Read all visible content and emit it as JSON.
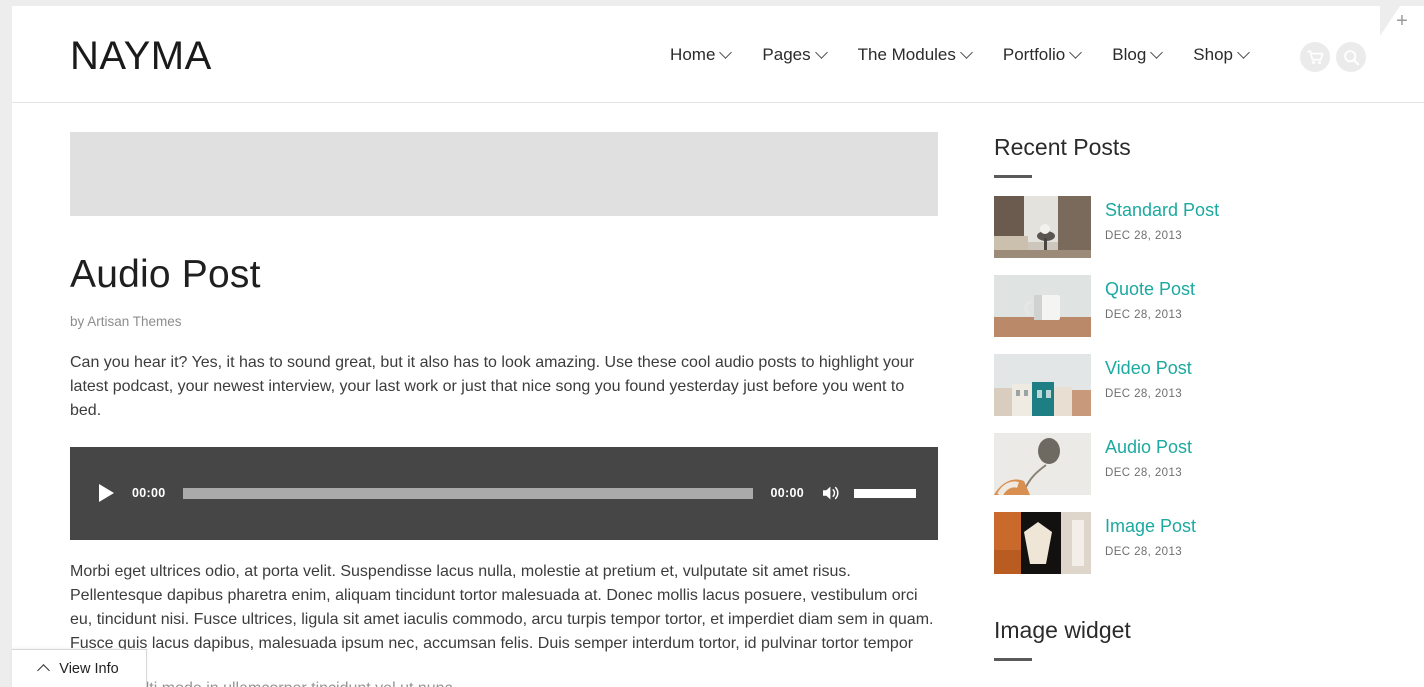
{
  "header": {
    "logo": "NAYMA",
    "nav": [
      {
        "label": "Home",
        "has_dropdown": true
      },
      {
        "label": "Pages",
        "has_dropdown": true
      },
      {
        "label": "The Modules",
        "has_dropdown": true
      },
      {
        "label": "Portfolio",
        "has_dropdown": true
      },
      {
        "label": "Blog",
        "has_dropdown": true
      },
      {
        "label": "Shop",
        "has_dropdown": true
      }
    ],
    "icons": [
      {
        "name": "cart-icon"
      },
      {
        "name": "search-icon"
      }
    ],
    "corner_toggle": "+"
  },
  "post": {
    "title": "Audio Post",
    "byline": "by Artisan Themes",
    "paragraph_1": "Can you hear it? Yes, it has to sound great, but it also has to look amazing. Use these cool audio posts to highlight your latest podcast, your newest interview, your last work or just that nice song you found yesterday just before you went to bed.",
    "paragraph_2": "Morbi eget ultrices odio, at porta velit. Suspendisse lacus nulla, molestie at pretium et, vulputate sit amet risus. Pellentesque dapibus pharetra enim, aliquam tincidunt tortor malesuada at. Donec mollis lacus posuere, vestibulum orci eu, tincidunt nisi. Fusce ultrices, ligula sit amet iaculis commodo, arcu turpis tempor tortor, et imperdiet diam sem in quam. Fusce quis lacus dapibus, malesuada ipsum nec, accumsan felis. Duis semper interdum tortor, id pulvinar tortor tempor non.",
    "paragraph_3_clipped": "Vivamus multi mode in ullamcorper tincidunt vel ut nunc"
  },
  "audio_player": {
    "current_time": "00:00",
    "duration": "00:00",
    "play_label": "play-button",
    "mute_label": "mute-button",
    "progress_percent": 0,
    "volume_percent": 100
  },
  "sidebar": {
    "recent_posts_widget": {
      "title": "Recent Posts",
      "posts": [
        {
          "title": "Standard Post",
          "date": "DEC 28, 2013",
          "thumb": "living-room"
        },
        {
          "title": "Quote Post",
          "date": "DEC 28, 2013",
          "thumb": "mug"
        },
        {
          "title": "Video Post",
          "date": "DEC 28, 2013",
          "thumb": "buildings"
        },
        {
          "title": "Audio Post",
          "date": "DEC 28, 2013",
          "thumb": "flowers-hand"
        },
        {
          "title": "Image Post",
          "date": "DEC 28, 2013",
          "thumb": "kitchen"
        }
      ]
    },
    "image_widget": {
      "title": "Image widget"
    }
  },
  "footer_bar": {
    "view_info_label": "View Info"
  },
  "colors": {
    "accent_teal": "#1ba9a0",
    "player_bg": "#464646",
    "placeholder_gray": "#e0e0e0",
    "page_bg": "#ededed",
    "text_dark": "#2b2b2b",
    "text_muted": "#8d8d8d"
  }
}
